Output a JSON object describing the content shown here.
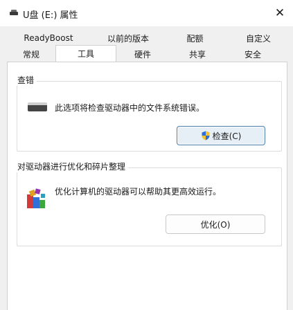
{
  "window": {
    "title": "U盘 (E:) 属性",
    "close_glyph": "✕"
  },
  "tabs": {
    "row1": [
      {
        "label": "ReadyBoost"
      },
      {
        "label": "以前的版本"
      },
      {
        "label": "配额"
      },
      {
        "label": "自定义"
      }
    ],
    "row2": [
      {
        "label": "常规"
      },
      {
        "label": "工具",
        "selected": true
      },
      {
        "label": "硬件"
      },
      {
        "label": "共享"
      },
      {
        "label": "安全"
      }
    ]
  },
  "error_check": {
    "title": "查错",
    "description": "此选项将检查驱动器中的文件系统错误。",
    "button_label": "检查(C)",
    "icon": "drive-icon"
  },
  "optimize": {
    "title": "对驱动器进行优化和碎片整理",
    "description": "优化计算机的驱动器可以帮助其更高效运行。",
    "button_label": "优化(O)",
    "icon": "defrag-icon"
  },
  "colors": {
    "accent_border": "#4a7ca8",
    "window_bg": "#f0f0f0",
    "panel_bg": "#ffffff"
  }
}
